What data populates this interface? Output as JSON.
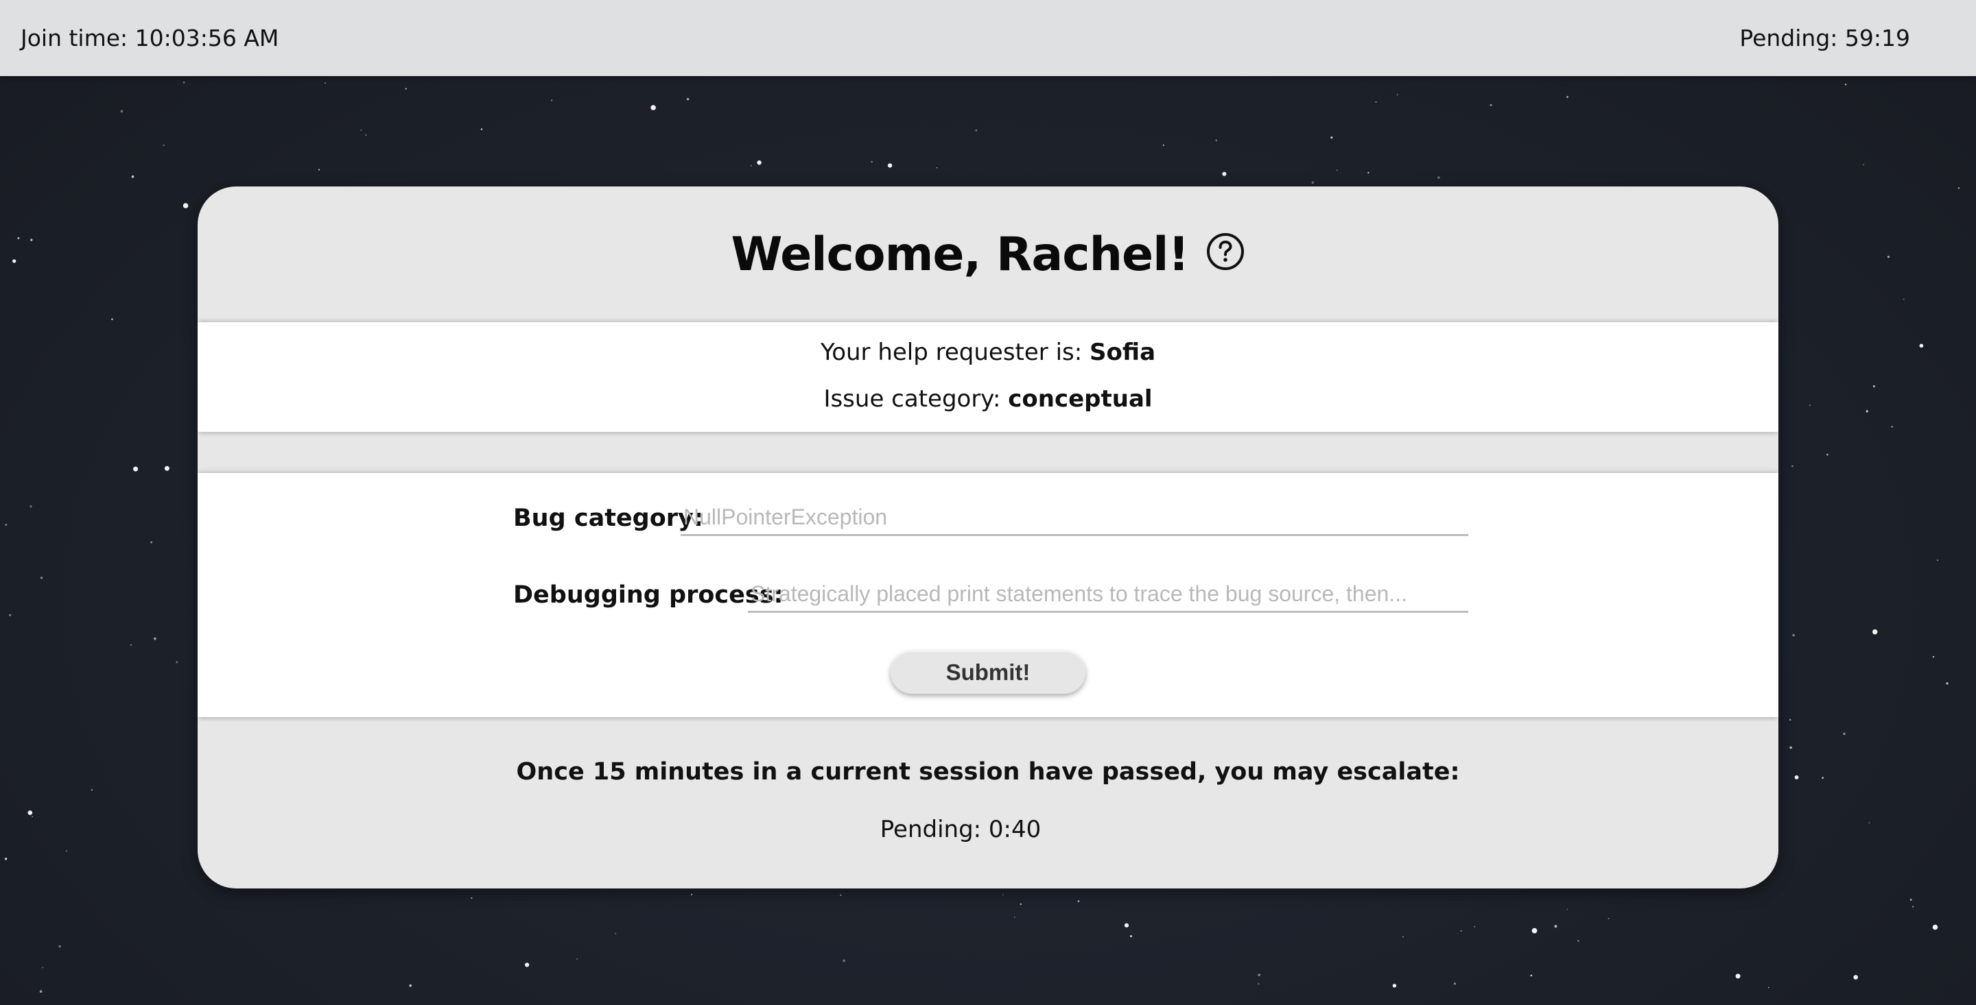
{
  "topbar": {
    "join_time": "Join time: 10:03:56 AM",
    "pending": "Pending: 59:19"
  },
  "card": {
    "title": "Welcome, Rachel!",
    "help_icon": "question-circle-icon",
    "requester_label": "Your help requester is:",
    "requester_name": "Sofia",
    "issue_label": "Issue category:",
    "issue_value": "conceptual"
  },
  "form": {
    "bug_category_label": "Bug category:",
    "bug_category_placeholder": "NullPointerException",
    "bug_category_value": "",
    "debugging_label": "Debugging process:",
    "debugging_placeholder": "Strategically placed print statements to trace the bug source, then...",
    "debugging_value": "",
    "submit_label": "Submit!"
  },
  "escalation": {
    "message": "Once 15 minutes in a current session have passed, you may escalate:",
    "pending": "Pending: 0:40"
  },
  "colors": {
    "background": "#1d222b",
    "topbar": "#dfe0e1",
    "card": "#e7e7e7",
    "band": "#ffffff"
  }
}
